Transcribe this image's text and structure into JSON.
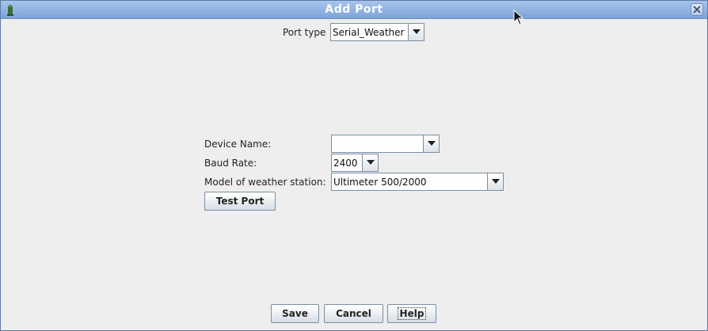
{
  "window": {
    "title": "Add Port"
  },
  "port_type": {
    "label": "Port type",
    "value": "Serial_Weather"
  },
  "device_name": {
    "label": "Device Name:",
    "value": ""
  },
  "baud_rate": {
    "label": "Baud Rate:",
    "value": "2400"
  },
  "weather_model": {
    "label": "Model of weather station:",
    "value": "Ultimeter 500/2000"
  },
  "test_port": {
    "label": "Test Port"
  },
  "footer": {
    "save": "Save",
    "cancel": "Cancel",
    "help": "Help"
  }
}
